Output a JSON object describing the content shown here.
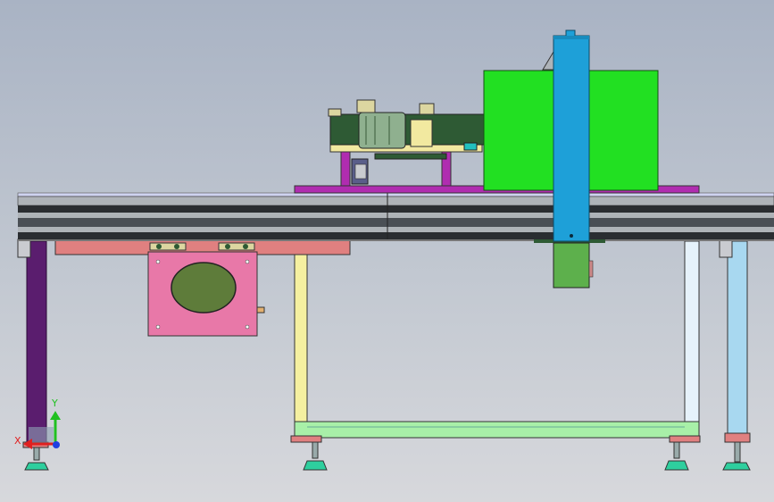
{
  "triad": {
    "x_label": "X",
    "y_label": "Y",
    "x_color": "#e02020",
    "y_color": "#20c020",
    "z_color": "#2040e0"
  },
  "colors": {
    "background_top": "#a9b3c4",
    "background_bottom": "#d7d8dc",
    "rail": "#4a4f55",
    "rail_light": "#aeb3b8",
    "left_leg": "#5a1d6e",
    "right_leg": "#a8d8f0",
    "frame_yellow": "#f5f0a0",
    "frame_green": "#a8f0a8",
    "pink_plate": "#e878a8",
    "olive_window": "#5e7c3a",
    "green_block": "#22e022",
    "blue_column": "#1ea0d8",
    "dark_green": "#2e5a34",
    "magenta_plate": "#b02cb0",
    "salmon_bar": "#e08080",
    "foot": "#2ecf9e"
  }
}
